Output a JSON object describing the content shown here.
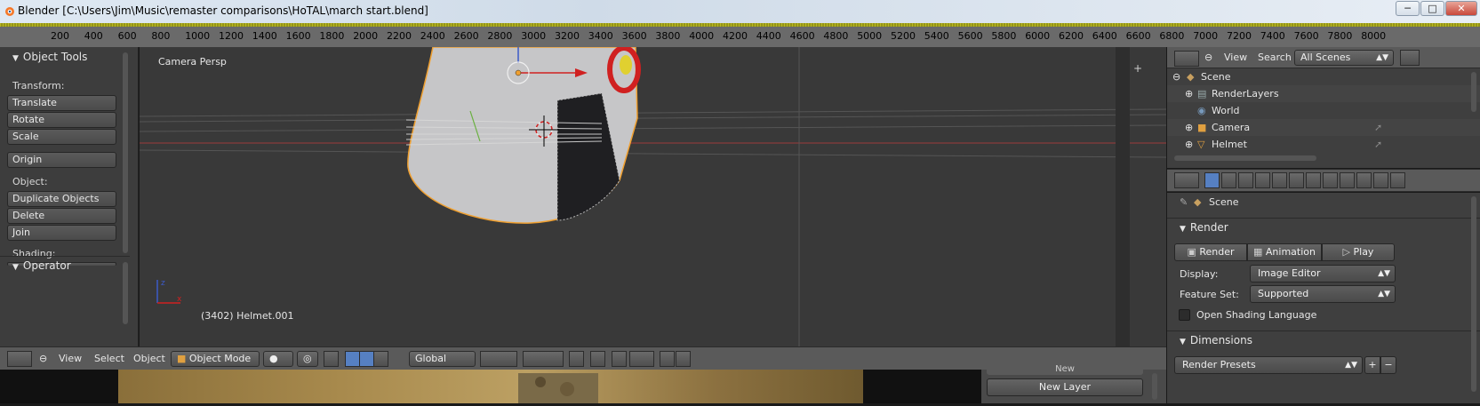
{
  "window": {
    "title": "Blender [C:\\Users\\Jim\\Music\\remaster comparisons\\HoTAL\\march start.blend]",
    "minimize": "─",
    "maximize": "□",
    "close": "✕"
  },
  "timeline": {
    "ticks": [
      "200",
      "400",
      "600",
      "800",
      "1000",
      "1200",
      "1400",
      "1600",
      "1800",
      "2000",
      "2200",
      "2400",
      "2600",
      "2800",
      "3000",
      "3200",
      "3400",
      "3600",
      "3800",
      "4000",
      "4200",
      "4400",
      "4600",
      "4800",
      "5000",
      "5200",
      "5400",
      "5600",
      "5800",
      "6000",
      "6200",
      "6400",
      "6600",
      "6800",
      "7000",
      "7200",
      "7400",
      "7600",
      "7800",
      "8000"
    ]
  },
  "toolshelf": {
    "title": "Object Tools",
    "transform_label": "Transform:",
    "translate": "Translate",
    "rotate": "Rotate",
    "scale": "Scale",
    "origin": "Origin",
    "object_label": "Object:",
    "duplicate": "Duplicate Objects",
    "delete": "Delete",
    "join": "Join",
    "shading_label": "Shading:",
    "operator_title": "Operator"
  },
  "viewport": {
    "camera_label": "Camera Persp",
    "object_label": "(3402) Helmet.001",
    "colors": {
      "background": "#393939",
      "selection": "#f0a030",
      "x_axis": "#c83c3c",
      "y_axis": "#6ab040",
      "z_axis": "#3c5ac8"
    }
  },
  "view_header": {
    "view_menu": "View",
    "select_menu": "Select",
    "object_menu": "Object",
    "mode": "Object Mode",
    "orientation": "Global"
  },
  "outliner": {
    "view_menu": "View",
    "search_menu": "Search",
    "scene_filter": "All Scenes",
    "items": [
      {
        "label": "Scene",
        "icon": "scene-icon"
      },
      {
        "label": "RenderLayers",
        "icon": "render-layers-icon"
      },
      {
        "label": "World",
        "icon": "world-icon"
      },
      {
        "label": "Camera",
        "icon": "camera-icon"
      },
      {
        "label": "Helmet",
        "icon": "mesh-icon"
      }
    ]
  },
  "properties": {
    "context": "Scene",
    "render_panel": "Render",
    "render_btn": "Render",
    "animation_btn": "Animation",
    "play_btn": "Play",
    "display_label": "Display:",
    "display_value": "Image Editor",
    "feature_label": "Feature Set:",
    "feature_value": "Supported",
    "osl_label": "Open Shading Language",
    "dimensions_panel": "Dimensions",
    "render_presets": "Render Presets",
    "add": "+",
    "remove": "−"
  },
  "layers": {
    "new_layer": "New Layer",
    "new_partial": "New"
  }
}
